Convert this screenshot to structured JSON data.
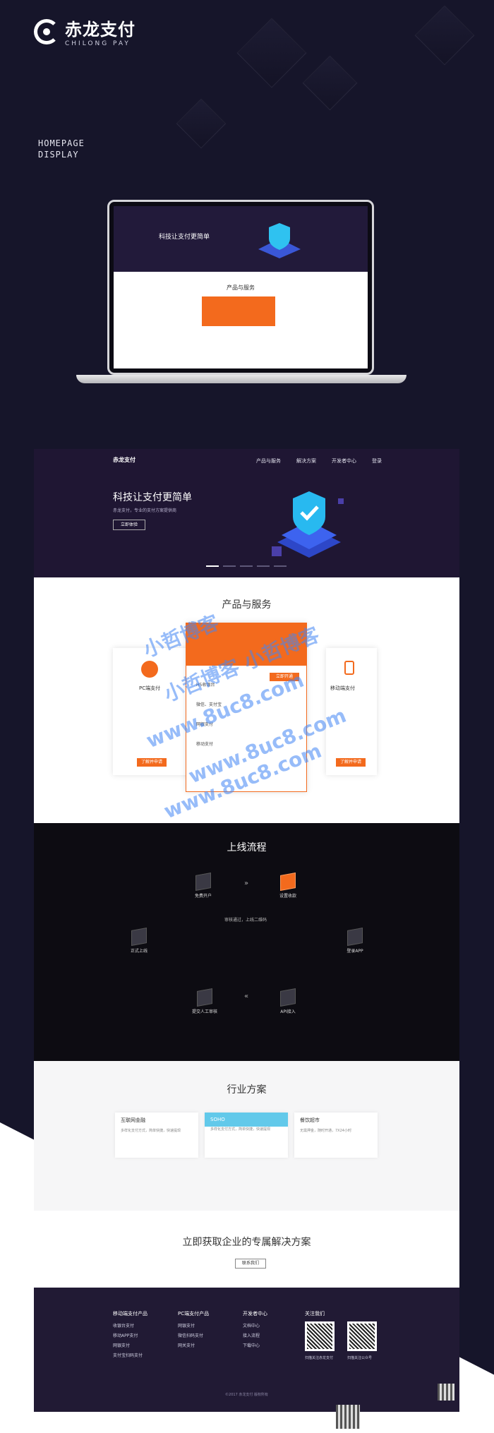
{
  "brand": {
    "name": "赤龙支付",
    "sub": "CHILONG PAY"
  },
  "display_label": [
    "HOMEPAGE",
    "DISPLAY"
  ],
  "laptop": {
    "hero_title": "科技让支付更简单",
    "section_title": "产品与服务"
  },
  "site": {
    "nav": [
      "产品与服务",
      "解决方案",
      "开发者中心",
      "登录"
    ],
    "hero_title": "科技让支付更简单",
    "hero_sub": "赤龙支付，专业的支付方案提供商",
    "hero_button": "立即体验",
    "products_title": "产品与服务",
    "product_cards": [
      {
        "title": "PC端支付",
        "button": "了解并申请"
      },
      {
        "title": "移动端支付",
        "button": "了解并申请"
      }
    ],
    "center_card": {
      "button": "立即开通",
      "items": [
        "H5收银台",
        "微信、支付宝",
        "网银支付",
        "移动支付"
      ]
    },
    "flow_title": "上线流程",
    "flow_nodes": [
      "免费开户",
      "设置收款",
      "正式上线",
      "提交人工审核",
      "API接入",
      "登录APP"
    ],
    "flow_center": "审核通过，上线二维码",
    "industry_title": "行业方案",
    "industry_cards": [
      {
        "title": "互联网金融",
        "desc": "多样化支付方式，简单快捷，快速提现"
      },
      {
        "title": "SOHO",
        "desc": "多样化支付方式，简单快捷，快速提现"
      },
      {
        "title": "餐饮超市",
        "desc": "无需押金，随时开通，7X24小时"
      }
    ],
    "cta_title": "立即获取企业的专属解决方案",
    "cta_button": "联系我们",
    "footer_cols": [
      {
        "title": "移动端支付产品",
        "items": [
          "收银台支付",
          "移动APP支付",
          "网银支付",
          "支付宝扫码支付"
        ]
      },
      {
        "title": "PC端支付产品",
        "items": [
          "网银支付",
          "微信扫码支付",
          "网关支付"
        ]
      },
      {
        "title": "开发者中心",
        "items": [
          "文档中心",
          "接入流程",
          "下载中心"
        ]
      },
      {
        "title": "关注我们",
        "items": []
      }
    ],
    "qr_labels": [
      "扫描关注赤龙支付",
      "扫描关注公众号"
    ],
    "copyright": "©2017 赤龙支付 版权所有"
  },
  "watermark": [
    "小哲博客",
    "小哲博客 小哲博客",
    "www.8uc8.com",
    "www.8uc8.com",
    "www.8uc8.com"
  ],
  "colors": {
    "accent": "#f36a1d",
    "dark": "#16152a",
    "soho": "#62c9ea"
  }
}
